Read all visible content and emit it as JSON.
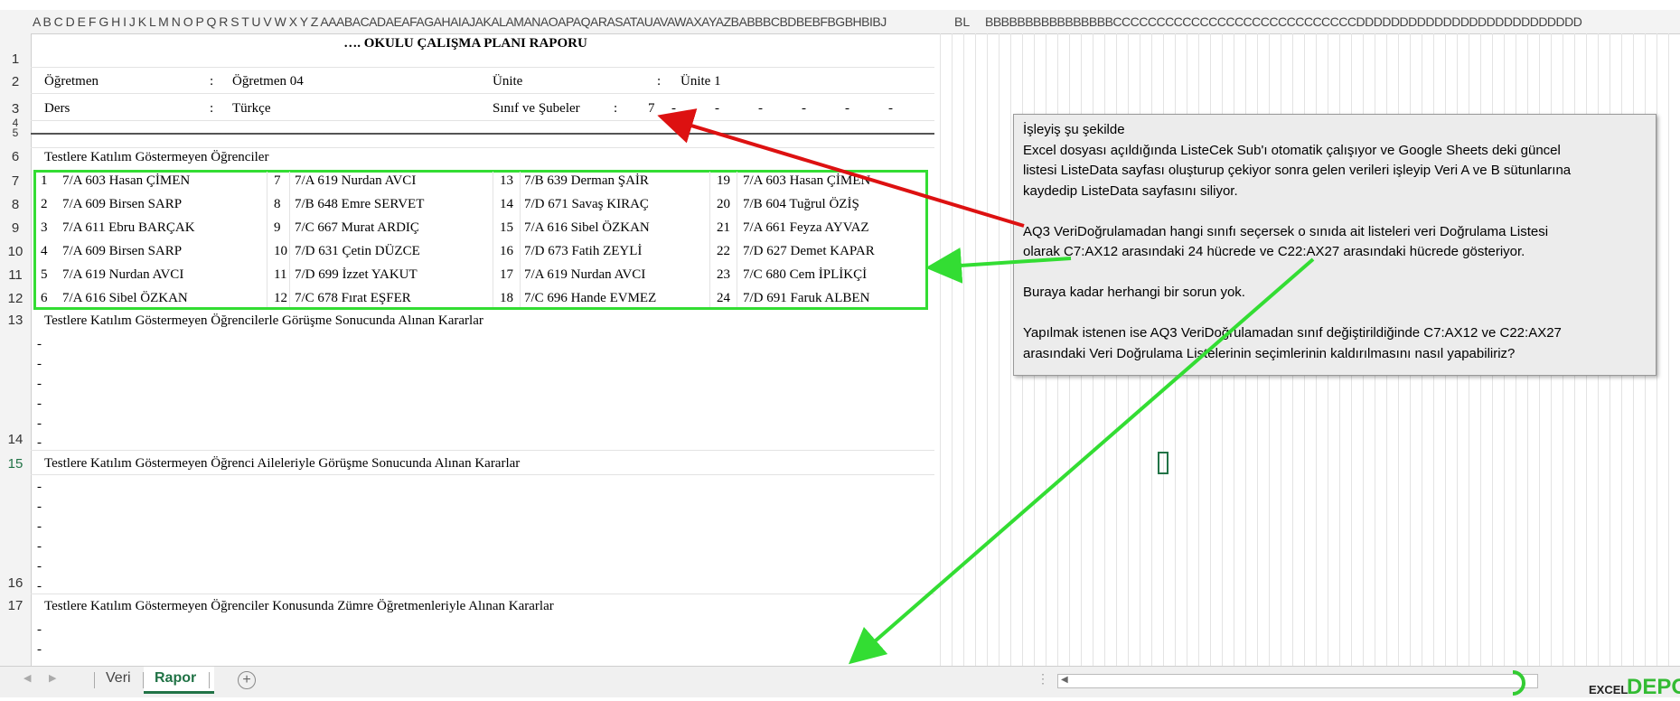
{
  "column_header_text": "A B C D E F G H I J K L M N O P Q R S T U V W X Y Z AAABACADAEAFAGAHAIAJAKALAMANAOAPAQARASATAUAVAWAXAYAZBABBBCBDBEBFBGBHBIBJ",
  "column_header_bl": "BL",
  "column_header_right": "BBBBBBBBBBBBBBBBCCCCCCCCCCCCCCCCCCCCCCCCCCCCDDDDDDDDDDDDDDDDDDDDDDDDDD",
  "row_numbers": [
    "1",
    "2",
    "3",
    "4",
    "5",
    "6",
    "7",
    "8",
    "9",
    "10",
    "11",
    "12",
    "13",
    "14",
    "15",
    "16",
    "17"
  ],
  "title": "…. OKULU ÇALIŞMA PLANI RAPORU",
  "header": {
    "teacher_label": "Öğretmen",
    "teacher_colon": ":",
    "teacher_value": "Öğretmen 04",
    "unit_label": "Ünite",
    "unit_colon": ":",
    "unit_value": "Ünite 1",
    "course_label": "Ders",
    "course_colon": ":",
    "course_value": "Türkçe",
    "class_label": "Sınıf ve Şubeler",
    "class_colon": ":",
    "class_value": "7",
    "class_dashes": [
      "-",
      "-",
      "-",
      "-",
      "-",
      "-"
    ]
  },
  "section1_title": "Testlere Katılım Göstermeyen Öğrenciler",
  "students": [
    [
      {
        "n": "1",
        "s": "7/A 603 Hasan ÇİMEN"
      },
      {
        "n": "7",
        "s": "7/A 619 Nurdan AVCI"
      },
      {
        "n": "13",
        "s": "7/B 639 Derman ŞAİR"
      },
      {
        "n": "19",
        "s": "7/A 603 Hasan ÇİMEN"
      }
    ],
    [
      {
        "n": "2",
        "s": "7/A 609 Birsen SARP"
      },
      {
        "n": "8",
        "s": "7/B 648 Emre SERVET"
      },
      {
        "n": "14",
        "s": "7/D 671 Savaş KIRAÇ"
      },
      {
        "n": "20",
        "s": "7/B 604 Tuğrul ÖZİŞ"
      }
    ],
    [
      {
        "n": "3",
        "s": "7/A 611 Ebru BARÇAK"
      },
      {
        "n": "9",
        "s": "7/C 667 Murat ARDIÇ"
      },
      {
        "n": "15",
        "s": "7/A 616 Sibel ÖZKAN"
      },
      {
        "n": "21",
        "s": "7/A 661 Feyza AYVAZ"
      }
    ],
    [
      {
        "n": "4",
        "s": "7/A 609 Birsen SARP"
      },
      {
        "n": "10",
        "s": "7/D 631 Çetin DÜZCE"
      },
      {
        "n": "16",
        "s": "7/D 673 Fatih ZEYLİ"
      },
      {
        "n": "22",
        "s": "7/D 627 Demet KAPAR"
      }
    ],
    [
      {
        "n": "5",
        "s": "7/A 619 Nurdan AVCI"
      },
      {
        "n": "11",
        "s": "7/D 699 İzzet YAKUT"
      },
      {
        "n": "17",
        "s": "7/A 619 Nurdan AVCI"
      },
      {
        "n": "23",
        "s": "7/C 680 Cem İPLİKÇİ"
      }
    ],
    [
      {
        "n": "6",
        "s": "7/A 616 Sibel ÖZKAN"
      },
      {
        "n": "12",
        "s": "7/C 678 Fırat EŞFER"
      },
      {
        "n": "18",
        "s": "7/C 696 Hande EVMEZ"
      },
      {
        "n": "24",
        "s": "7/D 691 Faruk ALBEN"
      }
    ]
  ],
  "section2_title": "Testlere Katılım Göstermeyen Öğrencilerle Görüşme Sonucunda Alınan Kararlar",
  "section3_title": "Testlere Katılım Göstermeyen Öğrenci Aileleriyle Görüşme Sonucunda Alınan Kararlar",
  "section4_title": "Testlere Katılım Göstermeyen Öğrenciler Konusunda Zümre Öğretmenleriyle Alınan Kararlar",
  "dash": "-",
  "comment": {
    "line1": "İşleyiş şu şekilde",
    "line2": "Excel dosyası açıldığında ListeCek Sub'ı otomatik çalışıyor ve Google Sheets deki güncel",
    "line3": "listesi ListeData sayfası oluşturup çekiyor sonra gelen verileri işleyip Veri A ve B sütunlarına",
    "line4": "kaydedip ListeData sayfasını siliyor.",
    "line5": "AQ3 VeriDoğrulamadan hangi sınıfı seçersek o sınıda ait listeleri veri Doğrulama Listesi",
    "line6": "olarak C7:AX12 arasındaki 24 hücrede ve C22:AX27 arasındaki hücrede gösteriyor.",
    "line7": "Buraya kadar herhangi bir sorun yok.",
    "line8": "Yapılmak istenen ise AQ3 VeriDoğrulamadan sınıf değiştirildiğinde C7:AX12 ve C22:AX27",
    "line9": "arasındaki Veri Doğrulama Listelerinin seçimlerinin kaldırılmasını nasıl yapabiliriz?"
  },
  "tabs": {
    "sheet1": "Veri",
    "sheet2": "Rapor",
    "add": "+",
    "nav_prev": "◀",
    "nav_next": "▶",
    "scroll_left": "◀",
    "ellipsis": "⋮"
  },
  "logo": {
    "left": "EXCEL",
    "right": "DEPO"
  },
  "colors": {
    "green_box": "#33dd33",
    "red_arrow": "#dd1111",
    "excel_green": "#217346"
  }
}
